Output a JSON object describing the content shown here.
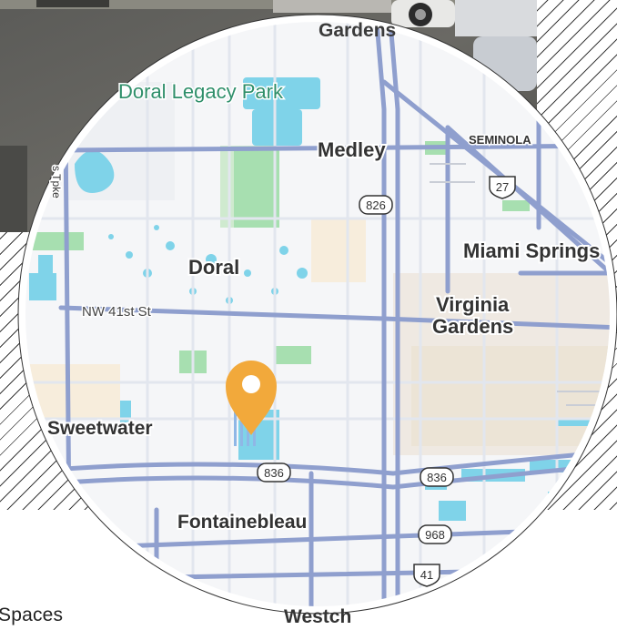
{
  "map": {
    "labels": {
      "gardens_top": "Gardens",
      "doral_legacy_park": "Doral Legacy Park",
      "medley": "Medley",
      "seminola": "SEMINOLA",
      "tpke": "s Tpke",
      "doral": "Doral",
      "miami_springs": "Miami Springs",
      "nw_41st": "NW 41st St",
      "virginia_gardens_1": "Virginia",
      "virginia_gardens_2": "Gardens",
      "sweetwater": "Sweetwater",
      "fontainebleau": "Fontainebleau",
      "westchester_partial": "Westch"
    },
    "shields": {
      "us27": "27",
      "r826": "826",
      "r836_left": "836",
      "r836_right": "836",
      "r968": "968",
      "us41": "41"
    },
    "marker_icon": "location-pin-icon",
    "marker_color": "#f2a93b",
    "colors": {
      "road": "#8f9fce",
      "water": "#7fd3e9",
      "park": "#a7dfb0",
      "land": "#f5f6f8",
      "label_green": "#2f8f6a"
    }
  },
  "caption": "Spaces"
}
